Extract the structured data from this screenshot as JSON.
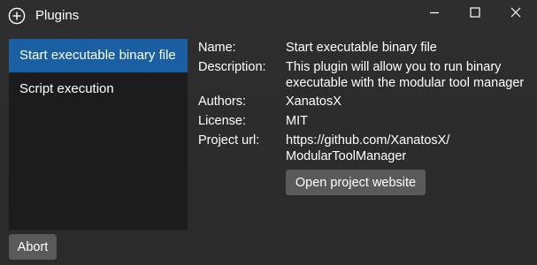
{
  "window": {
    "title": "Plugins",
    "app_icon": "add-circle-icon",
    "controls": [
      "minimize-icon",
      "maximize-icon",
      "close-icon"
    ]
  },
  "sidebar": {
    "items": [
      {
        "label": "Start executable binary file",
        "selected": true
      },
      {
        "label": "Script execution",
        "selected": false
      }
    ]
  },
  "details": {
    "name_label": "Name:",
    "name_value": "Start executable binary file",
    "description_label": "Description:",
    "description_line1": "This plugin will allow you to run binary",
    "description_line2": "executable with the modular tool manager",
    "authors_label": "Authors:",
    "authors_value": "XanatosX",
    "license_label": "License:",
    "license_value": "MIT",
    "project_url_label": "Project url:",
    "project_url_line1": "https://github.com/XanatosX/",
    "project_url_line2": "ModularToolManager"
  },
  "buttons": {
    "open_website": "Open project website",
    "abort": "Abort"
  },
  "colors": {
    "background": "#2b2b2b",
    "list_background": "#1c1c1c",
    "selection": "#1b5fa3",
    "button": "#5a5a5a",
    "text": "#ffffff"
  }
}
